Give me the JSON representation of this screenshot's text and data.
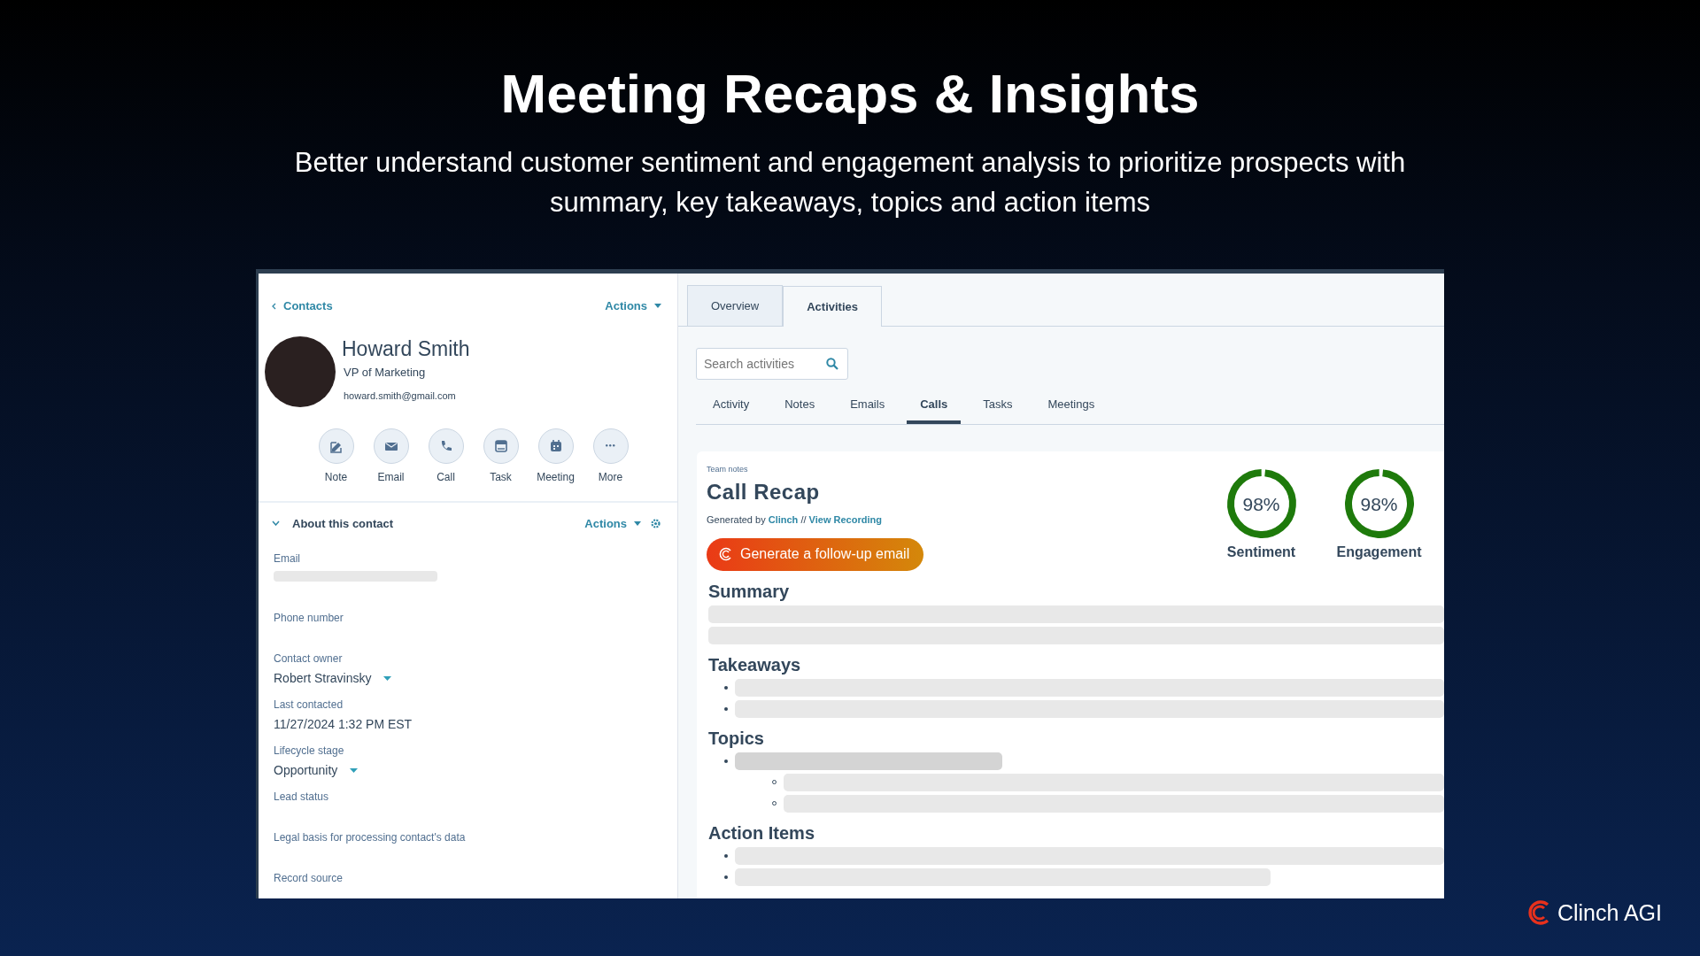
{
  "slide": {
    "title": "Meeting Recaps & Insights",
    "subtitle": "Better understand customer sentiment and engagement analysis to prioritize prospects with summary, key takeaways, topics and action items",
    "logo_text": "Clinch AGI"
  },
  "contact": {
    "back_link": "Contacts",
    "actions": "Actions",
    "name": "Howard Smith",
    "job_title": "VP of Marketing",
    "email": "howard.smith@gmail.com",
    "quick_actions": [
      {
        "kind": "note",
        "label": "Note"
      },
      {
        "kind": "email",
        "label": "Email"
      },
      {
        "kind": "call",
        "label": "Call"
      },
      {
        "kind": "task",
        "label": "Task"
      },
      {
        "kind": "meeting",
        "label": "Meeting"
      },
      {
        "kind": "more",
        "label": "More"
      }
    ],
    "about": {
      "title": "About this contact",
      "expanded": true,
      "actions": "Actions",
      "fields": [
        {
          "label": "Email",
          "kind": "redacted"
        },
        {
          "label": "Phone number",
          "kind": "empty"
        },
        {
          "label": "Contact owner",
          "kind": "dropdown",
          "value": "Robert Stravinsky"
        },
        {
          "label": "Last contacted",
          "kind": "text",
          "value": "11/27/2024 1:32 PM EST"
        },
        {
          "label": "Lifecycle stage",
          "kind": "dropdown",
          "value": "Opportunity"
        },
        {
          "label": "Lead status",
          "kind": "empty"
        },
        {
          "label": "Legal basis for processing contact's data",
          "kind": "empty"
        },
        {
          "label": "Record source",
          "kind": "last"
        }
      ]
    }
  },
  "tabs": [
    {
      "label": "Overview",
      "selected": false
    },
    {
      "label": "Activities",
      "selected": true
    }
  ],
  "search": {
    "placeholder": "Search activities"
  },
  "activity_tabs": [
    {
      "label": "Activity",
      "selected": false
    },
    {
      "label": "Notes",
      "selected": false
    },
    {
      "label": "Emails",
      "selected": false
    },
    {
      "label": "Calls",
      "selected": true
    },
    {
      "label": "Tasks",
      "selected": false
    },
    {
      "label": "Meetings",
      "selected": false
    }
  ],
  "recap": {
    "eyebrow": "Team notes",
    "title": "Call Recap",
    "generated_by": "Generated by",
    "generator_link": "Clinch",
    "separator": "//",
    "recording_link": "View Recording",
    "button": "Generate a follow-up email",
    "scores": [
      {
        "label": "Sentiment",
        "reading": "98%",
        "level": 0.98
      },
      {
        "label": "Engagement",
        "reading": "98%",
        "level": 0.98
      }
    ],
    "sections": [
      {
        "heading": "Summary",
        "items": [
          {
            "kind": "line"
          },
          {
            "kind": "line"
          }
        ]
      },
      {
        "heading": "Takeaways",
        "items": [
          {
            "kind": "bullet"
          },
          {
            "kind": "bullet"
          }
        ]
      },
      {
        "heading": "Topics",
        "items": [
          {
            "kind": "bullet",
            "short": true,
            "children": [
              {
                "kind": "bullet"
              },
              {
                "kind": "bullet"
              }
            ]
          }
        ]
      },
      {
        "heading": "Action Items",
        "items": [
          {
            "kind": "bullet"
          },
          {
            "kind": "bullet",
            "short": true
          }
        ]
      }
    ]
  }
}
